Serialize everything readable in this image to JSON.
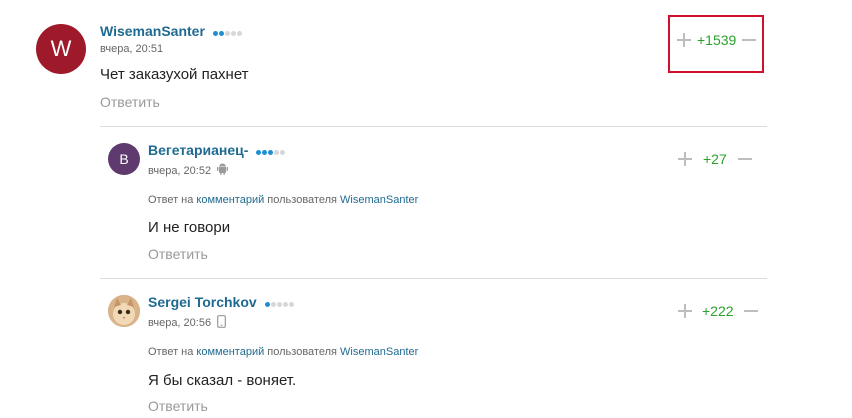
{
  "reply_to_prefix": "Ответ на",
  "reply_to_link": "комментарий",
  "reply_to_middle": "пользователя",
  "reply_label": "Ответить",
  "colors": {
    "username": "#1f6a91",
    "score_positive": "#2aa12a",
    "highlight": "#d0112b",
    "rank_dot_on": "#1f8fd1",
    "rank_dot_off": "#d7d7d7"
  },
  "comments": [
    {
      "avatar_letter": "W",
      "avatar_color": "#9e1a2a",
      "username": "WisemanSanter",
      "rank_dots_filled": 2,
      "rank_dots_total": 5,
      "time": "вчера, 20:51",
      "device": "",
      "text": "Чет заказухой пахнет",
      "score": "+1539"
    },
    {
      "avatar_letter": "В",
      "avatar_color": "#5e3a6e",
      "username": "Вегетарианец-",
      "rank_dots_filled": 3,
      "rank_dots_total": 5,
      "time": "вчера, 20:52",
      "device": "android-icon",
      "reply_to_user": "WisemanSanter",
      "text": "И не говори",
      "score": "+27"
    },
    {
      "avatar_letter": "",
      "avatar_color": "#c9a47a",
      "username": "Sergei Torchkov",
      "rank_dots_filled": 1,
      "rank_dots_total": 5,
      "time": "вчера, 20:56",
      "device": "phone-icon",
      "reply_to_user": "WisemanSanter",
      "text": "Я бы сказал - воняет.",
      "score": "+222"
    }
  ]
}
